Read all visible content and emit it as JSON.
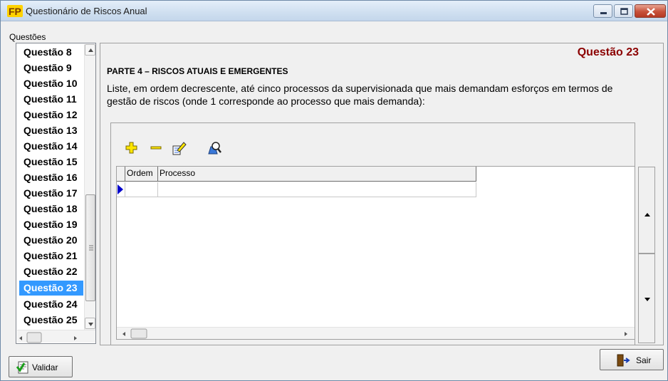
{
  "window": {
    "title": "Questionário de Riscos Anual",
    "logo_text": "FP"
  },
  "sidebar": {
    "label": "Questões",
    "items": [
      {
        "label": "Questão 8"
      },
      {
        "label": "Questão 9"
      },
      {
        "label": "Questão 10"
      },
      {
        "label": "Questão 11"
      },
      {
        "label": "Questão 12"
      },
      {
        "label": "Questão 13"
      },
      {
        "label": "Questão 14"
      },
      {
        "label": "Questão 15"
      },
      {
        "label": "Questão 16"
      },
      {
        "label": "Questão 17"
      },
      {
        "label": "Questão 18"
      },
      {
        "label": "Questão 19"
      },
      {
        "label": "Questão 20"
      },
      {
        "label": "Questão 21"
      },
      {
        "label": "Questão 22"
      },
      {
        "label": "Questão 23",
        "selected": true
      },
      {
        "label": "Questão 24"
      },
      {
        "label": "Questão 25"
      }
    ]
  },
  "main": {
    "question_number": "Questão 23",
    "part_title": "PARTE 4 – RISCOS ATUAIS E EMERGENTES",
    "question_text": "Liste, em ordem decrescente, até cinco processos da supervisionada que mais demandam esforços em termos de gestão de riscos (onde 1 corresponde ao processo que mais demanda):",
    "grid": {
      "columns": [
        "Ordem",
        "Processo"
      ],
      "rows": [
        [
          "",
          ""
        ]
      ]
    }
  },
  "buttons": {
    "validar": "Validar",
    "sair": "Sair"
  },
  "colors": {
    "accent_selected": "#3399ff",
    "question_number": "#8b0000",
    "row_indicator": "#0000cc"
  }
}
